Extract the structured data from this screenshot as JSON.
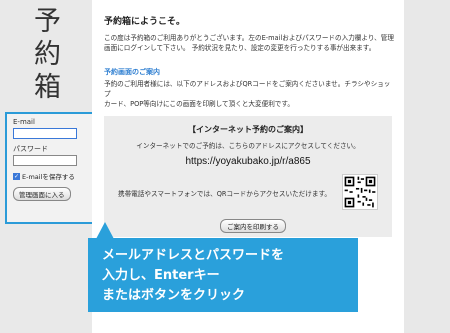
{
  "brand": {
    "logo_text": "予約箱"
  },
  "login": {
    "email_label": "E-mail",
    "email_value": "",
    "password_label": "パスワード",
    "password_value": "",
    "remember_label": "E-mailを保存する",
    "remember_checked": true,
    "submit_label": "管理画面に入る"
  },
  "main": {
    "heading": "予約箱にようこそ。",
    "intro_lines": [
      "この度は予約箱のご利用ありがとうございます。左のE-mailおよびパスワードの入力欄より、管理",
      "画面にログインして下さい。 予約状況を見たり、設定の変更を行ったりする事が出来ます。"
    ],
    "section_title": "予約画面のご案内",
    "section_lines": [
      "予約のご利用者様には、以下のアドレスおよびQRコードをご案内くださいませ。チラシやショップ",
      "カード、POP等向けにこの画面を印刷して頂くと大変便利です。"
    ],
    "info": {
      "title": "【インターネット予約のご案内】",
      "desc": "インターネットでのご予約は、こちらのアドレスにアクセスしてください。",
      "url": "https://yoyakubako.jp/r/a865",
      "mobile_text": "携帯電話やスマートフォンでは、QRコードからアクセスいただけます。",
      "print_label": "ご案内を印刷する"
    }
  },
  "callout": {
    "lines": [
      "メールアドレスとパスワードを",
      "入力し、Enterキー",
      "またはボタンをクリック"
    ],
    "color": "#2aa0db"
  }
}
